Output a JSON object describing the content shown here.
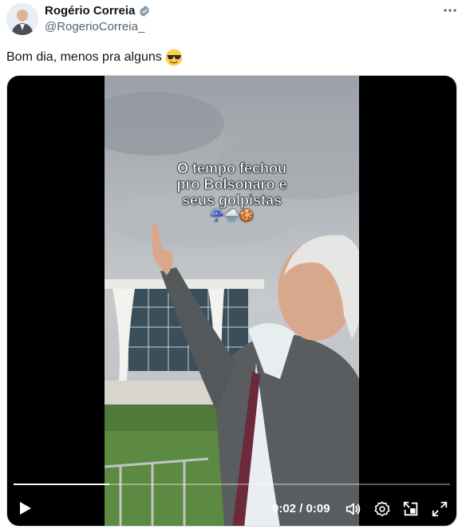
{
  "author": {
    "name": "Rogério Correia",
    "handle": "@RogerioCorreia_",
    "verified_icon": "verified-badge-icon"
  },
  "more_icon": "more-options-icon",
  "tweet": {
    "text": "Bom dia, menos pra alguns",
    "emoji": "smiling-face-with-sunglasses"
  },
  "video": {
    "caption_lines": [
      "O tempo fechou",
      "pro Bolsonaro e",
      "seus golpistas"
    ],
    "caption_emojis": "☔🌧️🍪",
    "current_time": "0:02",
    "duration": "0:09",
    "time_display": "0:02 / 0:09",
    "progress": 0.22,
    "controls": [
      "play-icon",
      "volume-icon",
      "settings-icon",
      "picture-in-picture-icon",
      "fullscreen-icon"
    ]
  },
  "colors": {
    "text": "#0f1419",
    "secondary": "#536471",
    "verified": "#829aab",
    "video_bg": "#000000"
  }
}
